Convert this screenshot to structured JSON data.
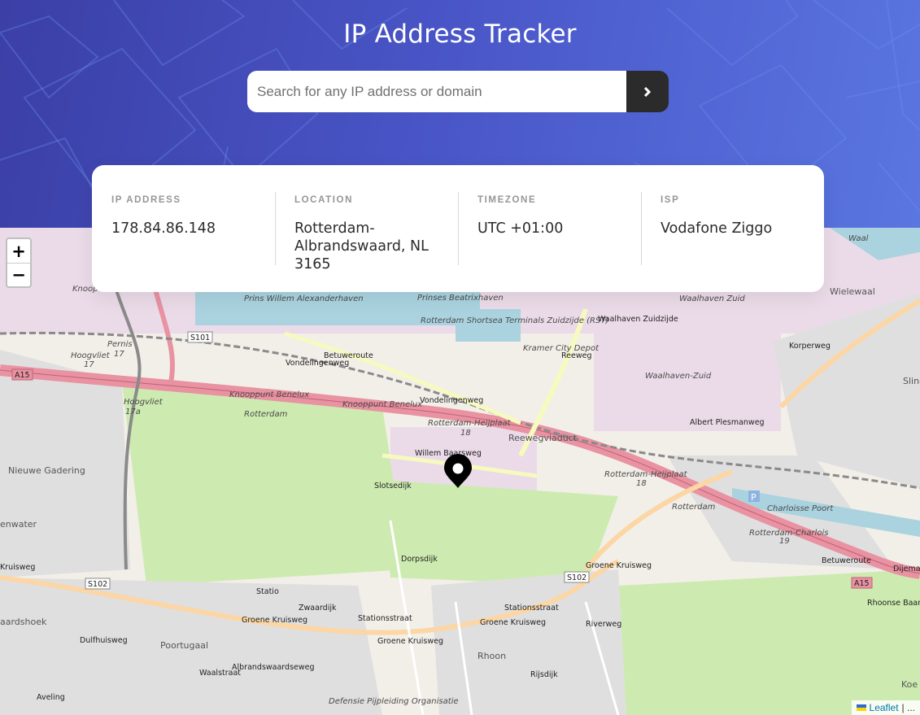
{
  "header": {
    "title": "IP Address Tracker",
    "search_placeholder": "Search for any IP address or domain",
    "search_value": "",
    "submit_icon": "chevron-right-icon",
    "gradient_colors": [
      "#3b3fa6",
      "#5a76e0"
    ]
  },
  "info": {
    "ip": {
      "label": "IP ADDRESS",
      "value": "178.84.86.148"
    },
    "location": {
      "label": "LOCATION",
      "value": "Rotterdam-Albrandswaard, NL 3165"
    },
    "timezone": {
      "label": "TIMEZONE",
      "value": "UTC +01:00"
    },
    "isp": {
      "label": "ISP",
      "value": "Vodafone Ziggo"
    }
  },
  "map": {
    "zoom_in": "+",
    "zoom_out": "−",
    "attribution_link": "Leaflet",
    "attribution_rest": "| ...",
    "marker_icon": "location-pin-icon",
    "labels": {
      "waalhaven_zuid": "Waalhaven-Zuid",
      "wielewaal": "Wielewaal",
      "waal": "Waal",
      "nieuwe_gadering": "Nieuwe Gadering",
      "poortugaal": "Poortugaal",
      "rhoon": "Rhoon",
      "charloisse_poort": "Charloisse Poort",
      "kramer_city_depot": "Kramer City Depot",
      "prinses_beatrixhaven": "Prinses Beatrixhaven",
      "rotterdam_shortsea": "Rotterdam Shortsea Terminals Zuidzijde (RST)",
      "prins_willem": "Prins Willem Alexanderhaven",
      "waalhaven_zuidzijde": "Waalhaven Zuidzijde",
      "waalhaven_zuid_top": "Waalhaven Zuid",
      "reewegviaduct": "Reewegviaduct",
      "albert_plesmanweg": "Albert Plesmanweg",
      "betuweroute": "Betuweroute",
      "vondelingenweg": "Vondelingenweg",
      "knooppunt_benelux": "Knooppunt Benelux",
      "rotterdam_heijplaat": "Rotterdam-Heijplaat",
      "rotterdam_charlois": "Rotterdam-Charlois",
      "rotterdam": "Rotterdam",
      "hoogvliet": "Hoogvliet",
      "pernis": "Pernis",
      "groene_kruisweg": "Groene Kruisweg",
      "zwaardijk": "Zwaardijk",
      "stationsstraat": "Stationsstraat",
      "dorpsdijk": "Dorpsdijk",
      "slotsedijk": "Slotsedijk",
      "reeweg": "Reeweg",
      "rijsdijk": "Rijsdijk",
      "waalstraat": "Waalstraat",
      "albrandswaardseweg": "Albrandswaardseweg",
      "aveling": "Aveling",
      "defensie": "Defensie Pijpleiding Organisatie",
      "rhoonse_baan": "Rhoonse Baan",
      "korperweg": "Korperweg",
      "kruisweg": "Kruisweg",
      "enwater": "enwater",
      "aardshoek": "aardshoek",
      "willem_baarsweg": "Willem Baarsweg",
      "dijemans": "Dijemans",
      "sling": "Sling",
      "riverweg": "Riverweg",
      "statio": "Statio",
      "knoop_top": "Knoop",
      "dulfhuisweg": "Dulfhuisweg",
      "koe": "Koe"
    },
    "shields": {
      "s101": "S101",
      "s102": "S102",
      "a15": "A15",
      "n18": "18",
      "n19": "19",
      "n17": "17",
      "n17a": "17a"
    }
  }
}
